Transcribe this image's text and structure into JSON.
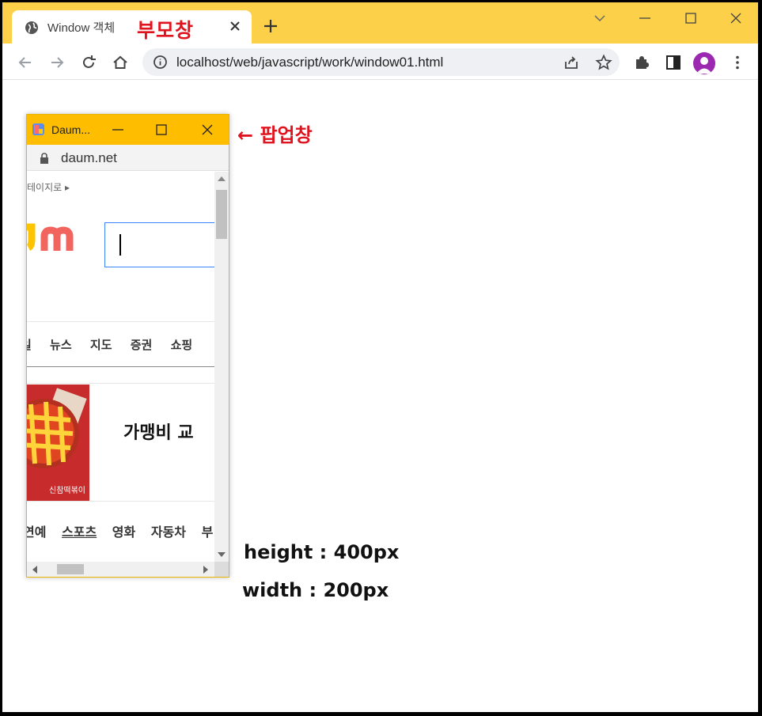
{
  "browser": {
    "tab_title": "Window 객체",
    "url": "localhost/web/javascript/work/window01.html",
    "accent_color": "#fdd049"
  },
  "annotations": {
    "parent_window": "부모창",
    "popup_window": "← 팝업창",
    "height": "height : 400px",
    "width": "width : 200px",
    "color": "#e0141e"
  },
  "popup": {
    "title": "Daum...",
    "address": "daum.net",
    "titlebar_color": "#ffbd00",
    "homepage_link": "테이지로 ▸",
    "nav_items": [
      "일",
      "뉴스",
      "지도",
      "증권",
      "쇼핑"
    ],
    "banner_text": "가맹비 교",
    "banner_label": "신참떡볶이",
    "nav_items2": [
      "연예",
      "스포츠",
      "영화",
      "자동차",
      "부"
    ]
  },
  "icons": {
    "tab_favicon": "globe-icon",
    "back": "back-arrow-icon",
    "forward": "forward-arrow-icon",
    "reload": "reload-icon",
    "home": "home-icon",
    "share": "share-icon",
    "bookmark": "star-icon",
    "extensions": "puzzle-icon",
    "sidepanel": "side-panel-icon",
    "menu": "kebab-menu-icon"
  }
}
